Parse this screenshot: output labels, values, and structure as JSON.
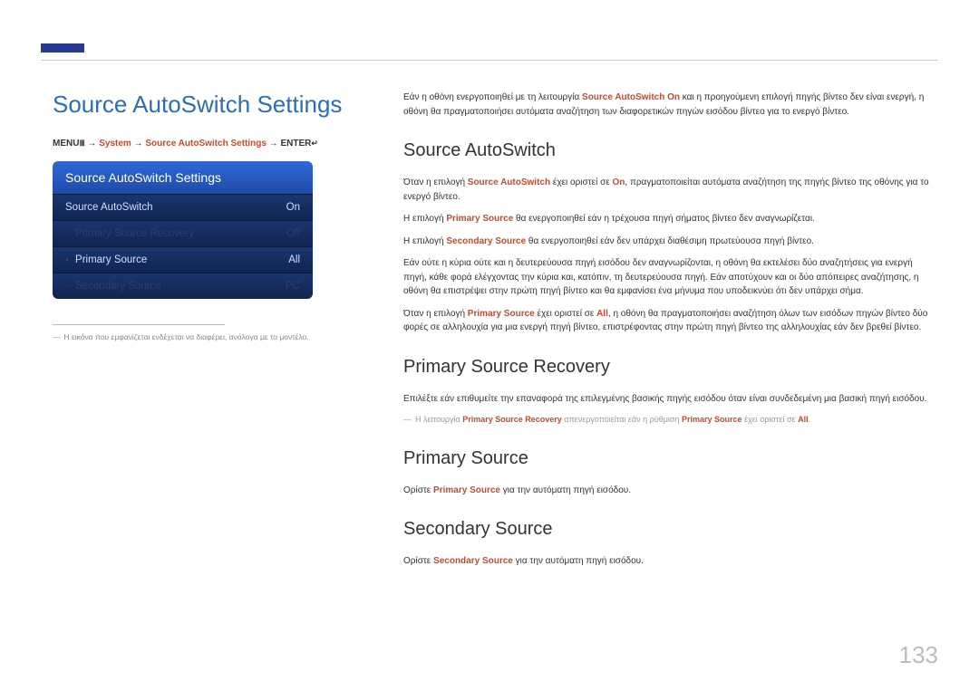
{
  "page_number": "133",
  "left": {
    "title": "Source AutoSwitch Settings",
    "breadcrumb": {
      "menu_label": "MENU",
      "menu_icon": "Ⅲ",
      "arrow": "→",
      "system": "System",
      "settings": "Source AutoSwitch Settings",
      "enter_label": "ENTER",
      "enter_icon": "↵"
    },
    "panel": {
      "header": "Source AutoSwitch Settings",
      "rows": [
        {
          "label": "Source AutoSwitch",
          "value": "On",
          "dim": false,
          "has_dot": false
        },
        {
          "label": "Primary Source Recovery",
          "value": "Off",
          "dim": true,
          "has_dot": true
        },
        {
          "label": "Primary Source",
          "value": "All",
          "dim": false,
          "has_dot": true
        },
        {
          "label": "Secondary Source",
          "value": "PC",
          "dim": true,
          "has_dot": true
        }
      ]
    },
    "footnote_prefix": "―",
    "footnote": "Η εικόνα που εμφανίζεται ενδέχεται να διαφέρει, ανάλογα με το μοντέλο."
  },
  "right": {
    "intro": {
      "p1_a": "Εάν η οθόνη ενεργοποιηθεί με τη λειτουργία ",
      "p1_b": "Source AutoSwitch On",
      "p1_c": " και η προηγούμενη επιλογή πηγής βίντεο δεν είναι ενεργή, η οθόνη θα πραγματοποιήσει αυτόματα αναζήτηση των διαφορετικών πηγών εισόδου βίντεο για το ενεργό βίντεο."
    },
    "s1": {
      "heading": "Source AutoSwitch",
      "p1_a": "Όταν η επιλογή ",
      "p1_b": "Source AutoSwitch",
      "p1_c": " έχει οριστεί σε ",
      "p1_d": "On",
      "p1_e": ", πραγματοποιείται αυτόματα αναζήτηση της πηγής βίντεο της οθόνης για το ενεργό βίντεο.",
      "p2_a": "Η επιλογή ",
      "p2_b": "Primary Source",
      "p2_c": " θα ενεργοποιηθεί εάν η τρέχουσα πηγή σήματος βίντεο δεν αναγνωρίζεται.",
      "p3_a": "Η επιλογή ",
      "p3_b": "Secondary Source",
      "p3_c": " θα ενεργοποιηθεί εάν δεν υπάρχει διαθέσιμη πρωτεύουσα πηγή βίντεο.",
      "p4": "Εάν ούτε η κύρια ούτε και η δευτερεύουσα πηγή εισόδου δεν αναγνωρίζονται, η οθόνη θα εκτελέσει δύο αναζητήσεις για ενεργή πηγή, κάθε φορά ελέγχοντας την κύρια και, κατόπιν, τη δευτερεύουσα πηγή. Εάν αποτύχουν και οι δύο απόπειρες αναζήτησης, η οθόνη θα επιστρέψει στην πρώτη πηγή βίντεο και θα εμφανίσει ένα μήνυμα που υποδεικνύει ότι δεν υπάρχει σήμα.",
      "p5_a": "Όταν η επιλογή ",
      "p5_b": "Primary Source",
      "p5_c": " έχει οριστεί σε ",
      "p5_d": "All",
      "p5_e": ", η οθόνη θα πραγματοποιήσει αναζήτηση όλων των εισόδων πηγών βίντεο δύο φορές σε αλληλουχία για μια ενεργή πηγή βίντεο, επιστρέφοντας στην πρώτη πηγή βίντεο της αλληλουχίας εάν δεν βρεθεί βίντεο."
    },
    "s2": {
      "heading": "Primary Source Recovery",
      "p1": "Επιλέξτε εάν επιθυμείτε την επαναφορά της επιλεγμένης βασικής πηγής εισόδου όταν είναι συνδεδεμένη μια βασική πηγή εισόδου.",
      "note_prefix": "―",
      "note_a": "Η λειτουργία ",
      "note_b": "Primary Source Recovery",
      "note_c": " απενεργοποιείται εάν η ρύθμιση ",
      "note_d": "Primary Source",
      "note_e": " έχει οριστεί σε ",
      "note_f": "All",
      "note_g": "."
    },
    "s3": {
      "heading": "Primary Source",
      "p1_a": "Ορίστε ",
      "p1_b": "Primary Source",
      "p1_c": " για την αυτόματη πηγή εισόδου."
    },
    "s4": {
      "heading": "Secondary Source",
      "p1_a": "Ορίστε ",
      "p1_b": "Secondary Source",
      "p1_c": " για την αυτόματη πηγή εισόδου."
    }
  }
}
